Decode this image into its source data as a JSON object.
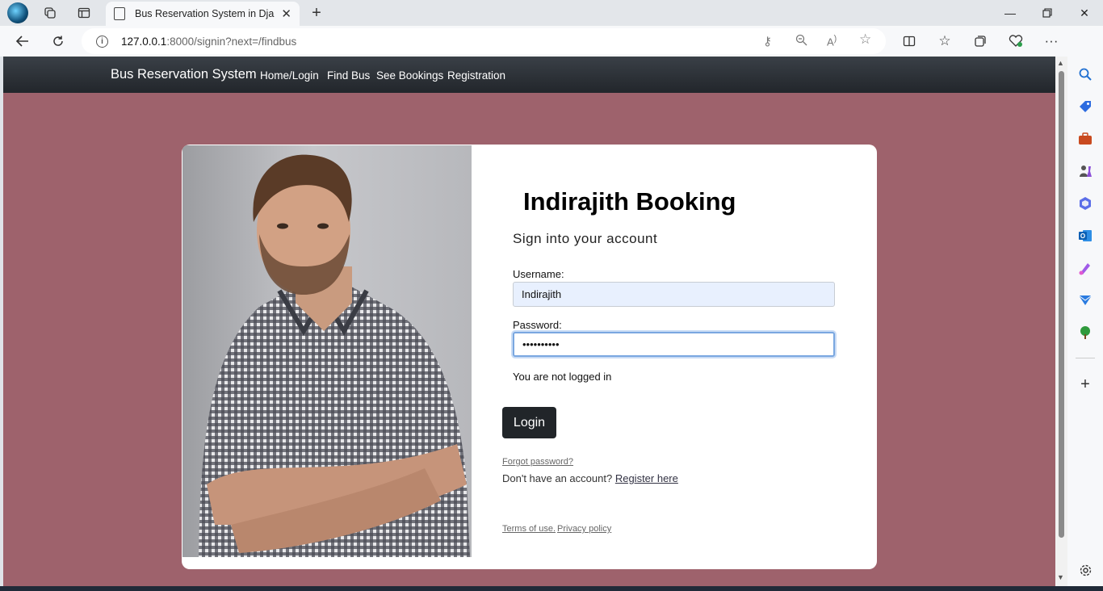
{
  "browser": {
    "tab_title": "Bus Reservation System in Django",
    "url_host": "127.0.0.1",
    "url_rest": ":8000/signin?next=/findbus"
  },
  "navbar": {
    "brand": "Bus Reservation System",
    "links": [
      "Home/Login",
      "Find Bus",
      "See Bookings",
      "Registration"
    ]
  },
  "form": {
    "heading": "Indirajith Booking",
    "subheading": "Sign into your account",
    "username_label": "Username:",
    "username_value": "Indirajith",
    "password_label": "Password:",
    "password_value": "••••••••••",
    "status": "You are not logged in",
    "login_button": "Login",
    "forgot_password": "Forgot password?",
    "no_account_text": "Don't have an account?",
    "register_link": "Register here",
    "terms": "Terms of use.",
    "privacy": "Privacy policy"
  },
  "colors": {
    "page_background": "#9e626c",
    "navbar": "#2b3035",
    "button": "#212529"
  }
}
